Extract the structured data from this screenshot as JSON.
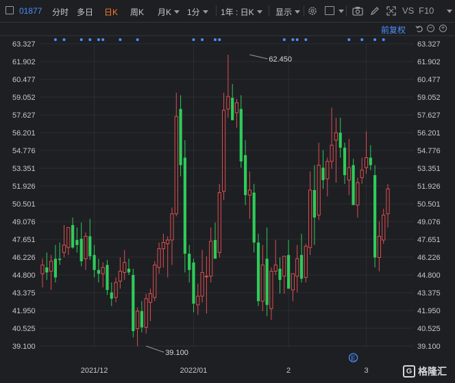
{
  "toolbar": {
    "code": "01877",
    "tabs": [
      "分时",
      "多日",
      "日K",
      "周K",
      "月K",
      "1分",
      "1年 : 日K",
      "显示"
    ],
    "active_tab": "日K",
    "vs_label": "VS",
    "f10_label": "F10"
  },
  "chart_controls": {
    "adjust_label": "前复权"
  },
  "watermark": {
    "text": "格隆汇",
    "logo_letter": "G"
  },
  "colors": {
    "background": "#1e1f23",
    "up": "#e04f4f",
    "down": "#2ecc5a",
    "accent": "#4a90ff",
    "active": "#ff7a2e"
  },
  "chart_data": {
    "type": "candlestick",
    "title": "",
    "xlabel": "",
    "ylabel": "",
    "ylim": [
      39.1,
      63.327
    ],
    "y_ticks": [
      "63.327",
      "61.902",
      "60.477",
      "59.052",
      "57.627",
      "56.201",
      "54.776",
      "53.351",
      "51.926",
      "50.501",
      "49.076",
      "47.651",
      "46.226",
      "44.800",
      "43.375",
      "41.950",
      "40.525",
      "39.100"
    ],
    "x_labels": [
      {
        "label": "2021/12",
        "index": 12
      },
      {
        "label": "2022/01",
        "index": 35
      },
      {
        "label": "2",
        "index": 57
      },
      {
        "label": "3",
        "index": 75
      }
    ],
    "annotations": [
      {
        "label": "62.450",
        "index": 48,
        "value": 62.45
      },
      {
        "label": "39.100",
        "index": 24,
        "value": 39.1
      }
    ],
    "event_marker": {
      "label": "E",
      "index": 72
    },
    "dot_indices": [
      3,
      5,
      9,
      11,
      13,
      14,
      18,
      22,
      35,
      37,
      40,
      41,
      56,
      58,
      59,
      61,
      71,
      74,
      77,
      79
    ],
    "candles": [
      {
        "o": 44.9,
        "h": 46.1,
        "l": 43.8,
        "c": 45.6
      },
      {
        "o": 45.4,
        "h": 46.6,
        "l": 44.4,
        "c": 45.0
      },
      {
        "o": 45.1,
        "h": 46.4,
        "l": 43.6,
        "c": 45.9
      },
      {
        "o": 46.1,
        "h": 47.2,
        "l": 44.2,
        "c": 44.6
      },
      {
        "o": 46.1,
        "h": 47.4,
        "l": 45.6,
        "c": 46.0
      },
      {
        "o": 46.6,
        "h": 48.8,
        "l": 46.2,
        "c": 47.2
      },
      {
        "o": 47.0,
        "h": 48.4,
        "l": 46.4,
        "c": 48.6
      },
      {
        "o": 48.8,
        "h": 49.4,
        "l": 46.9,
        "c": 47.0
      },
      {
        "o": 47.6,
        "h": 48.6,
        "l": 46.6,
        "c": 47.2
      },
      {
        "o": 47.7,
        "h": 49.0,
        "l": 45.5,
        "c": 45.9
      },
      {
        "o": 46.1,
        "h": 48.2,
        "l": 45.2,
        "c": 47.9
      },
      {
        "o": 47.9,
        "h": 49.3,
        "l": 46.0,
        "c": 46.3
      },
      {
        "o": 46.4,
        "h": 47.2,
        "l": 44.6,
        "c": 45.2
      },
      {
        "o": 45.2,
        "h": 46.1,
        "l": 44.2,
        "c": 44.9
      },
      {
        "o": 44.9,
        "h": 45.8,
        "l": 43.8,
        "c": 45.4
      },
      {
        "o": 45.6,
        "h": 46.0,
        "l": 43.2,
        "c": 43.6
      },
      {
        "o": 43.4,
        "h": 44.2,
        "l": 42.3,
        "c": 42.9
      },
      {
        "o": 43.0,
        "h": 44.6,
        "l": 42.6,
        "c": 44.2
      },
      {
        "o": 44.3,
        "h": 46.2,
        "l": 43.7,
        "c": 45.1
      },
      {
        "o": 45.0,
        "h": 46.8,
        "l": 44.4,
        "c": 45.8
      },
      {
        "o": 45.3,
        "h": 46.1,
        "l": 44.8,
        "c": 45.0
      },
      {
        "o": 44.8,
        "h": 45.3,
        "l": 39.8,
        "c": 40.3
      },
      {
        "o": 40.5,
        "h": 42.2,
        "l": 39.1,
        "c": 41.9
      },
      {
        "o": 41.9,
        "h": 42.7,
        "l": 40.2,
        "c": 40.6
      },
      {
        "o": 40.6,
        "h": 43.3,
        "l": 40.1,
        "c": 42.9
      },
      {
        "o": 42.6,
        "h": 43.7,
        "l": 41.1,
        "c": 43.3
      },
      {
        "o": 43.0,
        "h": 45.9,
        "l": 42.7,
        "c": 45.6
      },
      {
        "o": 45.4,
        "h": 47.4,
        "l": 44.9,
        "c": 46.9
      },
      {
        "o": 46.9,
        "h": 48.1,
        "l": 45.4,
        "c": 47.4
      },
      {
        "o": 47.3,
        "h": 47.9,
        "l": 44.6,
        "c": 47.6
      },
      {
        "o": 47.6,
        "h": 50.2,
        "l": 45.6,
        "c": 49.7
      },
      {
        "o": 49.7,
        "h": 59.4,
        "l": 49.5,
        "c": 57.5
      },
      {
        "o": 58.1,
        "h": 59.2,
        "l": 52.7,
        "c": 53.6
      },
      {
        "o": 54.2,
        "h": 55.6,
        "l": 45.0,
        "c": 46.5
      },
      {
        "o": 46.5,
        "h": 47.2,
        "l": 44.2,
        "c": 45.2
      },
      {
        "o": 45.8,
        "h": 46.1,
        "l": 41.8,
        "c": 42.5
      },
      {
        "o": 42.4,
        "h": 44.1,
        "l": 41.6,
        "c": 43.1
      },
      {
        "o": 43.1,
        "h": 46.8,
        "l": 42.6,
        "c": 45.0
      },
      {
        "o": 44.7,
        "h": 46.3,
        "l": 41.7,
        "c": 44.7
      },
      {
        "o": 44.7,
        "h": 48.6,
        "l": 44.2,
        "c": 47.5
      },
      {
        "o": 47.6,
        "h": 49.0,
        "l": 46.4,
        "c": 46.1
      },
      {
        "o": 46.6,
        "h": 52.1,
        "l": 46.2,
        "c": 51.4
      },
      {
        "o": 51.5,
        "h": 59.4,
        "l": 50.8,
        "c": 58.0
      },
      {
        "o": 58.1,
        "h": 62.45,
        "l": 57.4,
        "c": 59.1
      },
      {
        "o": 59.0,
        "h": 60.1,
        "l": 57.8,
        "c": 57.2
      },
      {
        "o": 57.8,
        "h": 58.9,
        "l": 56.6,
        "c": 58.6
      },
      {
        "o": 58.1,
        "h": 59.2,
        "l": 53.4,
        "c": 53.9
      },
      {
        "o": 54.4,
        "h": 55.6,
        "l": 50.4,
        "c": 51.2
      },
      {
        "o": 51.2,
        "h": 53.1,
        "l": 49.3,
        "c": 51.6
      },
      {
        "o": 51.4,
        "h": 52.1,
        "l": 46.6,
        "c": 47.4
      },
      {
        "o": 47.4,
        "h": 48.1,
        "l": 42.3,
        "c": 42.7
      },
      {
        "o": 42.7,
        "h": 47.2,
        "l": 41.9,
        "c": 45.6
      },
      {
        "o": 46.1,
        "h": 48.6,
        "l": 41.5,
        "c": 42.4
      },
      {
        "o": 42.1,
        "h": 45.4,
        "l": 41.2,
        "c": 45.1
      },
      {
        "o": 45.1,
        "h": 47.6,
        "l": 44.8,
        "c": 45.6
      },
      {
        "o": 45.3,
        "h": 46.2,
        "l": 43.3,
        "c": 44.4
      },
      {
        "o": 44.7,
        "h": 46.0,
        "l": 43.3,
        "c": 46.3
      },
      {
        "o": 46.4,
        "h": 47.6,
        "l": 45.3,
        "c": 43.7
      },
      {
        "o": 43.6,
        "h": 44.6,
        "l": 42.7,
        "c": 44.9
      },
      {
        "o": 44.7,
        "h": 47.2,
        "l": 43.4,
        "c": 46.1
      },
      {
        "o": 46.4,
        "h": 48.1,
        "l": 44.2,
        "c": 44.5
      },
      {
        "o": 44.6,
        "h": 47.3,
        "l": 44.2,
        "c": 47.1
      },
      {
        "o": 47.0,
        "h": 53.1,
        "l": 46.4,
        "c": 51.6
      },
      {
        "o": 51.6,
        "h": 53.6,
        "l": 47.2,
        "c": 49.4
      },
      {
        "o": 49.6,
        "h": 55.4,
        "l": 49.2,
        "c": 53.6
      },
      {
        "o": 53.4,
        "h": 54.8,
        "l": 51.7,
        "c": 52.4
      },
      {
        "o": 52.5,
        "h": 54.2,
        "l": 51.1,
        "c": 53.9
      },
      {
        "o": 53.9,
        "h": 58.2,
        "l": 53.3,
        "c": 55.2
      },
      {
        "o": 55.6,
        "h": 57.4,
        "l": 52.2,
        "c": 56.2
      },
      {
        "o": 56.2,
        "h": 57.4,
        "l": 54.2,
        "c": 55.0
      },
      {
        "o": 55.0,
        "h": 55.4,
        "l": 52.1,
        "c": 52.8
      },
      {
        "o": 52.4,
        "h": 55.7,
        "l": 51.2,
        "c": 53.4
      },
      {
        "o": 53.6,
        "h": 54.1,
        "l": 51.3,
        "c": 50.4
      },
      {
        "o": 50.4,
        "h": 52.6,
        "l": 49.4,
        "c": 52.2
      },
      {
        "o": 52.6,
        "h": 54.2,
        "l": 52.1,
        "c": 53.2
      },
      {
        "o": 53.4,
        "h": 56.3,
        "l": 52.9,
        "c": 54.2
      },
      {
        "o": 54.2,
        "h": 55.2,
        "l": 53.2,
        "c": 53.6
      },
      {
        "o": 52.8,
        "h": 53.6,
        "l": 45.4,
        "c": 46.2
      },
      {
        "o": 46.2,
        "h": 49.1,
        "l": 45.1,
        "c": 47.9
      },
      {
        "o": 47.6,
        "h": 50.1,
        "l": 47.3,
        "c": 49.6
      },
      {
        "o": 49.7,
        "h": 52.1,
        "l": 48.6,
        "c": 51.7
      }
    ]
  }
}
